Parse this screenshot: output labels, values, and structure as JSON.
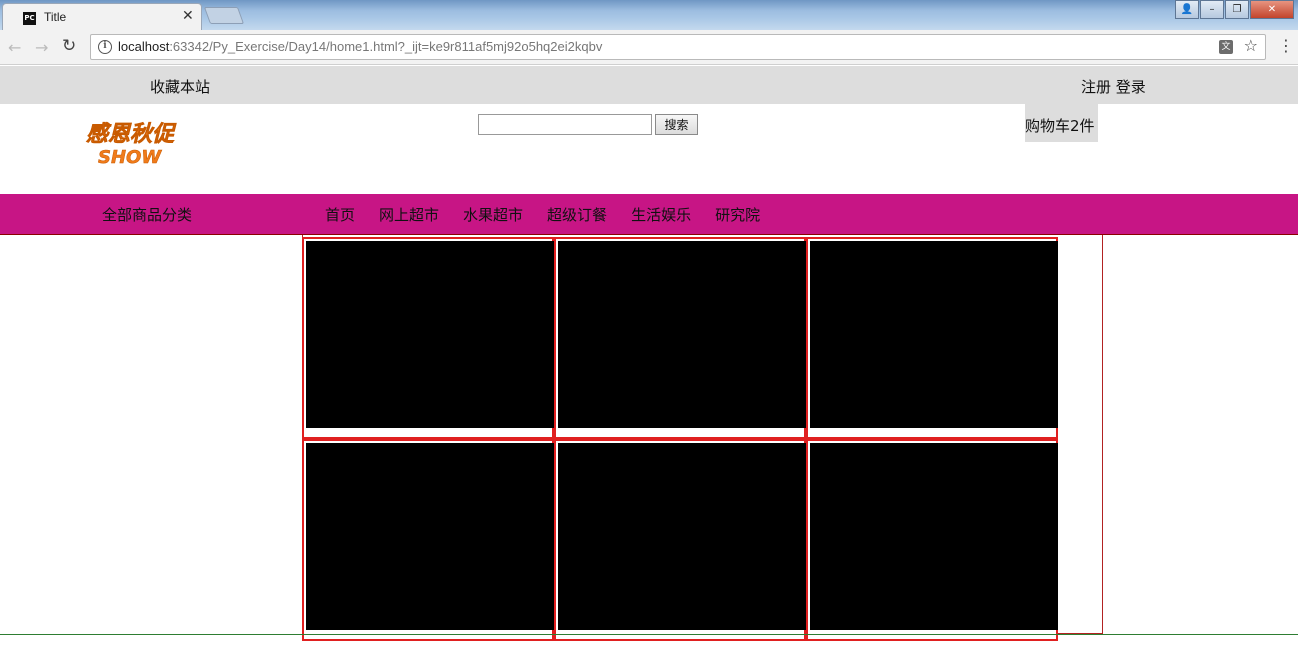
{
  "browser": {
    "tab_title": "Title",
    "tab_icon_text": "PC",
    "close_glyph": "✕",
    "url_host": "localhost",
    "url_rest": ":63342/Py_Exercise/Day14/home1.html?_ijt=ke9r811af5mj92o5hq2ei2kqbv",
    "icons": [
      "back-arrow-icon",
      "forward-arrow-icon",
      "reload-icon",
      "info-icon",
      "translate-icon",
      "star-icon",
      "menu-icon"
    ]
  },
  "topbar": {
    "favorite": "收藏本站",
    "register": "注册",
    "login": "登录"
  },
  "header": {
    "logo_line1": "感恩秋促",
    "logo_line2": "SHOW",
    "search_button": "搜索",
    "search_value": "",
    "cart": "购物车2件"
  },
  "nav": {
    "all_categories": "全部商品分类",
    "links": [
      "首页",
      "网上超市",
      "水果超市",
      "超级订餐",
      "生活娱乐",
      "研究院"
    ]
  },
  "grid": {
    "rows": 2,
    "cols": 3
  },
  "colors": {
    "nav_bg": "#c71585",
    "topbar_bg": "#dddddd",
    "logo": "#f07b1a",
    "cell_border": "#e02020"
  }
}
